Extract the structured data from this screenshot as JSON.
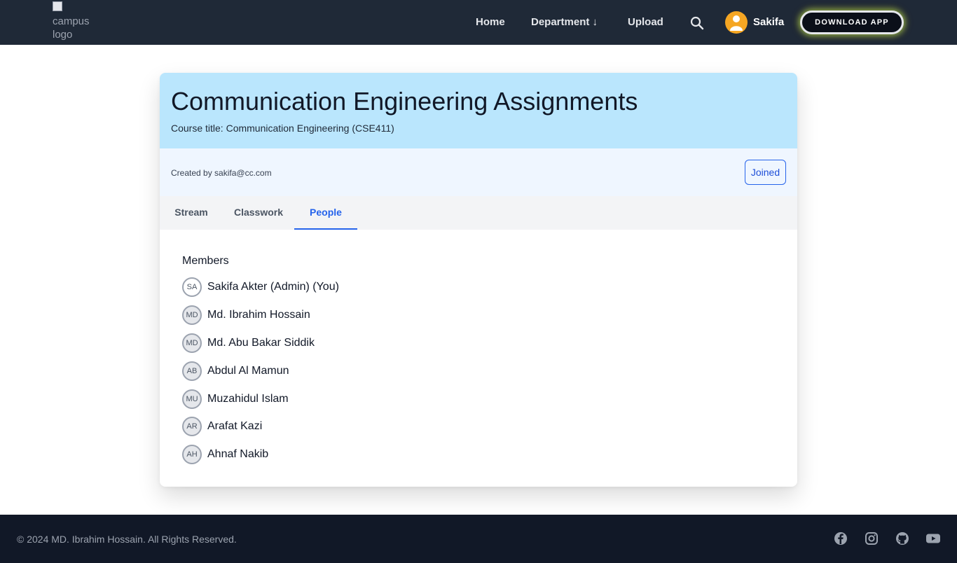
{
  "header": {
    "logo_alt": "campus logo",
    "nav": {
      "home": "Home",
      "department": "Department ↓",
      "upload": "Upload"
    },
    "search_icon": "search-icon",
    "user_name": "Sakifa",
    "download_label": "DOWNLOAD APP"
  },
  "course": {
    "title": "Communication Engineering Assignments",
    "subtitle": "Course title: Communication Engineering (CSE411)",
    "created_by": "Created by sakifa@cc.com",
    "joined_label": "Joined"
  },
  "tabs": [
    {
      "label": "Stream",
      "active": false
    },
    {
      "label": "Classwork",
      "active": false
    },
    {
      "label": "People",
      "active": true
    }
  ],
  "members": {
    "heading": "Members",
    "list": [
      {
        "initials": "SA",
        "name": "Sakifa Akter (Admin) (You)"
      },
      {
        "initials": "MD",
        "name": "Md. Ibrahim Hossain"
      },
      {
        "initials": "MD",
        "name": "Md. Abu Bakar Siddik"
      },
      {
        "initials": "AB",
        "name": "Abdul Al Mamun"
      },
      {
        "initials": "MU",
        "name": "Muzahidul Islam"
      },
      {
        "initials": "AR",
        "name": "Arafat Kazi"
      },
      {
        "initials": "AH",
        "name": "Ahnaf Nakib"
      }
    ]
  },
  "footer": {
    "copyright": "© 2024 MD. Ibrahim Hossain. All Rights Reserved.",
    "social_icons": [
      "facebook-icon",
      "instagram-icon",
      "github-icon",
      "youtube-icon"
    ]
  },
  "colors": {
    "header_bg": "#1f2937",
    "course_header_bg": "#bae6fd",
    "meta_bg": "#eff6ff",
    "accent": "#2563eb",
    "footer_bg": "#111827",
    "avatar_bg": "#f5a623"
  }
}
